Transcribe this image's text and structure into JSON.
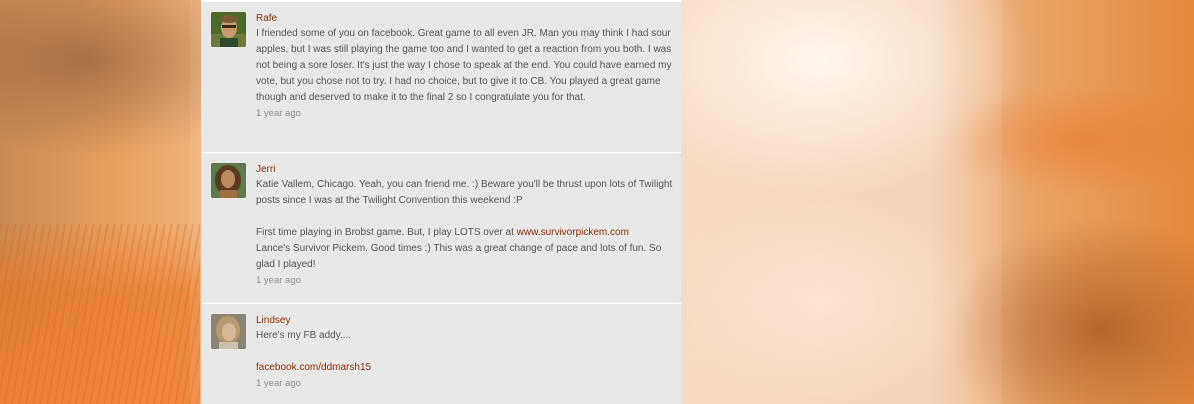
{
  "comments": [
    {
      "author": "Rafe",
      "text": "I friended some of you on facebook.  Great game to all even JR.  Man you may think I had sour apples, but I was still playing the game too and I wanted to get a reaction from you both.  I was not being a sore loser.  It's just the way I chose to speak at the end.  You could have earned my vote, but you chose not to try.  I had no choice, but to give it to CB.  You played a great game though and deserved to make it to the final 2 so I congratulate you for that.",
      "time": "1 year ago"
    },
    {
      "author": "Jerri",
      "text_p1": "Katie Vallem, Chicago. Yeah, you can friend me. :) Beware you'll be thrust upon lots of Twilight posts since I was at the Twilight Convention this weekend :P",
      "text_p2_before": "First time playing in Brobst game. But, I play LOTS over at ",
      "link": "www.survivorpickem.com",
      "text_p2_after": "Lance's Survivor Pickem. Good times :) This was a great change of pace and lots of fun. So glad I played!",
      "time": "1 year ago"
    },
    {
      "author": "Lindsey",
      "text": "Here's my FB addy....",
      "link": "facebook.com/ddmarsh15",
      "time": "1 year ago"
    }
  ],
  "colors": {
    "author": "#8a3200",
    "text": "#555555",
    "time": "#8f8f8f",
    "panel": "#e8e8e8"
  }
}
